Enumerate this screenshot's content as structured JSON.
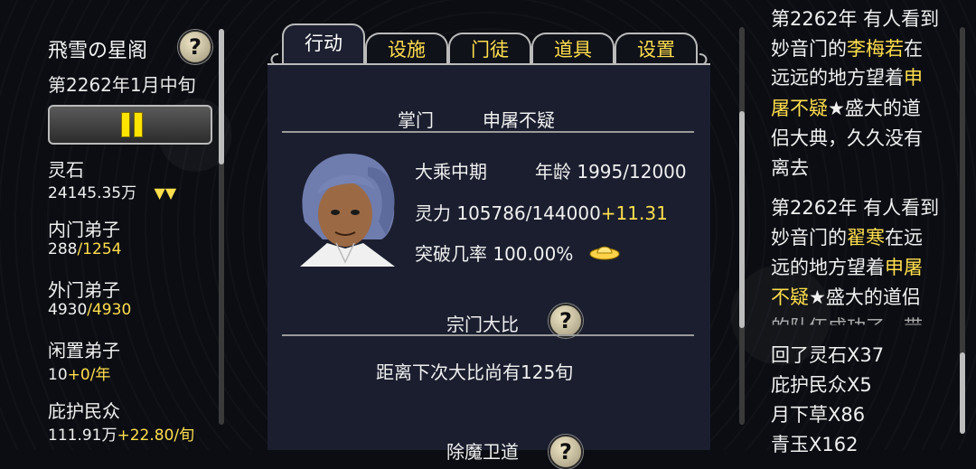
{
  "sidebar": {
    "sect_name": "飛雪の星阁",
    "date": "第2262年1月中旬",
    "stats": [
      {
        "label": "灵石",
        "value": "24145.35万",
        "suffix": "▼▼"
      },
      {
        "label": "内门弟子",
        "value": "288",
        "suffix": "/1254"
      },
      {
        "label": "外门弟子",
        "value": "4930",
        "suffix": "/4930"
      },
      {
        "label": "闲置弟子",
        "value": "10",
        "suffix": "+0/年"
      },
      {
        "label": "庇护民众",
        "value": "111.91万",
        "suffix": "+22.80/旬"
      }
    ]
  },
  "tabs": [
    {
      "label": "行动",
      "active": true
    },
    {
      "label": "设施",
      "active": false
    },
    {
      "label": "门徒",
      "active": false
    },
    {
      "label": "道具",
      "active": false
    },
    {
      "label": "设置",
      "active": false
    }
  ],
  "leader": {
    "title": "掌门",
    "name": "申屠不疑",
    "realm": "大乘中期",
    "age_label": "年龄",
    "age": "1995/12000",
    "power_label": "灵力",
    "power": "105786/144000",
    "power_rate": "+11.31",
    "breakthrough_label": "突破几率",
    "breakthrough": "100.00%"
  },
  "tournament": {
    "title": "宗门大比",
    "info": "距离下次大比尚有125旬"
  },
  "next_section": {
    "title": "除魔卫道"
  },
  "log": [
    [
      {
        "t": "第2262年 有人看到",
        "c": "w"
      }
    ],
    [
      {
        "t": "妙音门的",
        "c": "w"
      },
      {
        "t": "李梅若",
        "c": "y"
      },
      {
        "t": "在",
        "c": "w"
      }
    ],
    [
      {
        "t": "远远的地方望着",
        "c": "w"
      },
      {
        "t": "申",
        "c": "y"
      }
    ],
    [
      {
        "t": "屠不疑",
        "c": "y"
      },
      {
        "t": "★盛大的道",
        "c": "w"
      }
    ],
    [
      {
        "t": "侣大典，久久没有",
        "c": "w"
      }
    ],
    [
      {
        "t": "离去",
        "c": "w"
      }
    ],
    [
      {
        "t": "第2262年 有人看到",
        "c": "w"
      }
    ],
    [
      {
        "t": "妙音门的",
        "c": "w"
      },
      {
        "t": "翟寒",
        "c": "y"
      },
      {
        "t": "在远",
        "c": "w"
      }
    ],
    [
      {
        "t": "远的地方望着",
        "c": "w"
      },
      {
        "t": "申屠",
        "c": "y"
      }
    ],
    [
      {
        "t": "不疑",
        "c": "y"
      },
      {
        "t": "★盛大的道侣",
        "c": "w"
      }
    ],
    [
      {
        "t": "回了灵石X37",
        "c": "w"
      }
    ],
    [
      {
        "t": "庇护民众X5",
        "c": "w"
      }
    ],
    [
      {
        "t": "月下草X86",
        "c": "w"
      }
    ],
    [
      {
        "t": "青玉X162",
        "c": "w"
      }
    ]
  ],
  "log_overlap": "的队伍成功了，带",
  "colors": {
    "accent": "#ffdf4d",
    "panel": "#1a1e2e",
    "background": "#0b0d12"
  }
}
